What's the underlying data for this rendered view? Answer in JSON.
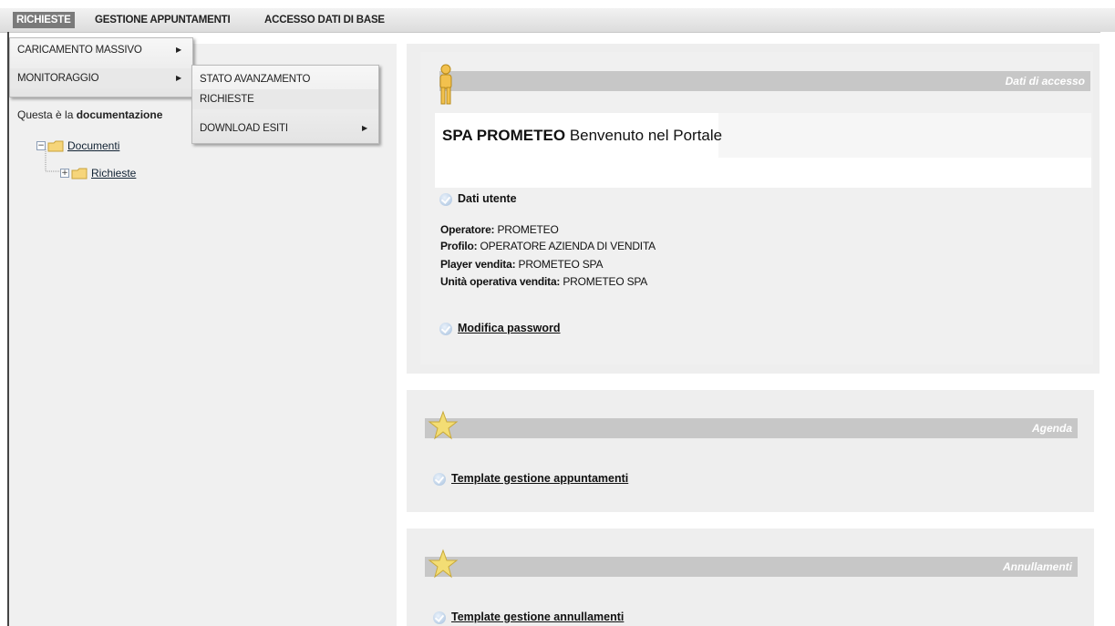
{
  "menubar": {
    "items": [
      "RICHIESTE",
      "GESTIONE APPUNTAMENTI",
      "ACCESSO DATI DI BASE"
    ]
  },
  "dropdown": {
    "level1": [
      "CARICAMENTO MASSIVO",
      "MONITORAGGIO"
    ],
    "level2": [
      "STATO AVANZAMENTO",
      "RICHIESTE",
      "DOWNLOAD ESITI"
    ]
  },
  "leftpanel": {
    "intro_prefix": "Questa è la ",
    "intro_bold": "documentazione",
    "tree": {
      "root": "Documenti",
      "child": "Richieste"
    }
  },
  "access": {
    "title": "Dati di accesso",
    "company": "SPA PROMETEO",
    "welcome": "Benvenuto nel Portale",
    "user_heading": "Dati utente",
    "fields": [
      {
        "label": "Operatore:",
        "value": "PROMETEO"
      },
      {
        "label": "Profilo:",
        "value": "OPERATORE AZIENDA DI VENDITA"
      },
      {
        "label": "Player vendita:",
        "value": "PROMETEO SPA"
      },
      {
        "label": "Unità operativa vendita:",
        "value": "PROMETEO SPA"
      }
    ],
    "password_link": "Modifica password"
  },
  "agenda": {
    "title": "Agenda",
    "link": "Template gestione appuntamenti"
  },
  "annullamenti": {
    "title": "Annullamenti",
    "link": "Template gestione annullamenti"
  },
  "colors": {
    "menu_active": "#7a7a7a",
    "panel_bg": "#eeeeee",
    "bar_bg": "#c7c7c7"
  }
}
